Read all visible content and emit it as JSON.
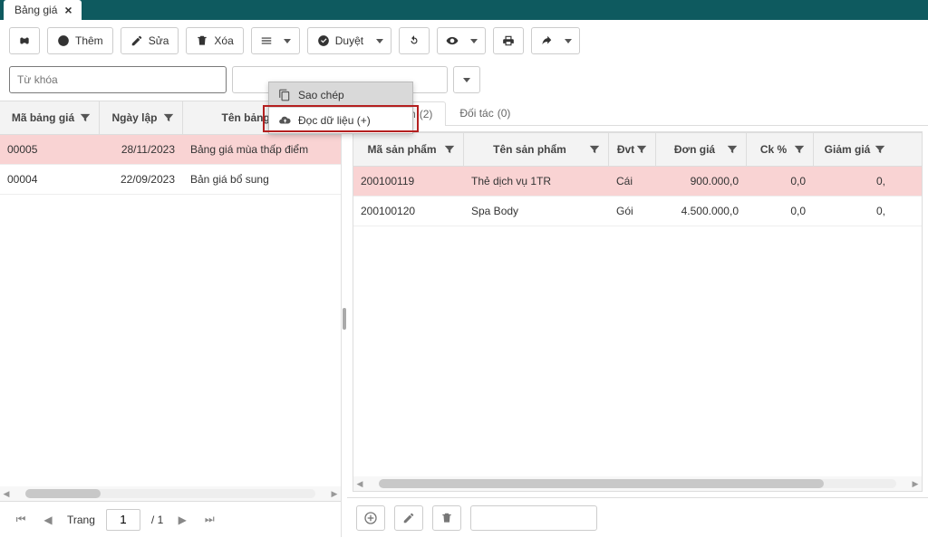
{
  "app_tab": {
    "title": "Bảng giá"
  },
  "toolbar": {
    "add": "Thêm",
    "edit": "Sửa",
    "delete": "Xóa",
    "approve": "Duyệt"
  },
  "menu": {
    "copy": "Sao chép",
    "read_data": "Đọc dữ liệu (+)"
  },
  "search": {
    "placeholder": "Từ khóa"
  },
  "left_grid": {
    "headers": {
      "code": "Mã bảng giá",
      "date": "Ngày lập",
      "name": "Tên bảng giá"
    },
    "rows": [
      {
        "code": "00005",
        "date": "28/11/2023",
        "name": "Bảng giá mùa thấp điểm"
      },
      {
        "code": "00004",
        "date": "22/09/2023",
        "name": "Bản giá bổ sung"
      }
    ],
    "hscroll_thumb_pct": 26,
    "pager": {
      "label": "Trang",
      "current": "1",
      "total": "/ 1"
    }
  },
  "right_pane": {
    "tabs": [
      {
        "label": "Sản phẩm",
        "count": "(2)",
        "active": true
      },
      {
        "label": "Đối tác",
        "count": "(0)",
        "active": false
      }
    ],
    "headers": {
      "code": "Mã sản phẩm",
      "name": "Tên sản phẩm",
      "unit": "Đvt",
      "price": "Đơn giá",
      "ck": "Ck %",
      "discount": "Giảm giá"
    },
    "rows": [
      {
        "code": "200100119",
        "name": "Thẻ dịch vụ 1TR",
        "unit": "Cái",
        "price": "900.000,0",
        "ck": "0,0",
        "discount": "0,"
      },
      {
        "code": "200100120",
        "name": "Spa Body",
        "unit": "Gói",
        "price": "4.500.000,0",
        "ck": "0,0",
        "discount": "0,"
      }
    ],
    "hscroll_thumb_pct": 86
  }
}
